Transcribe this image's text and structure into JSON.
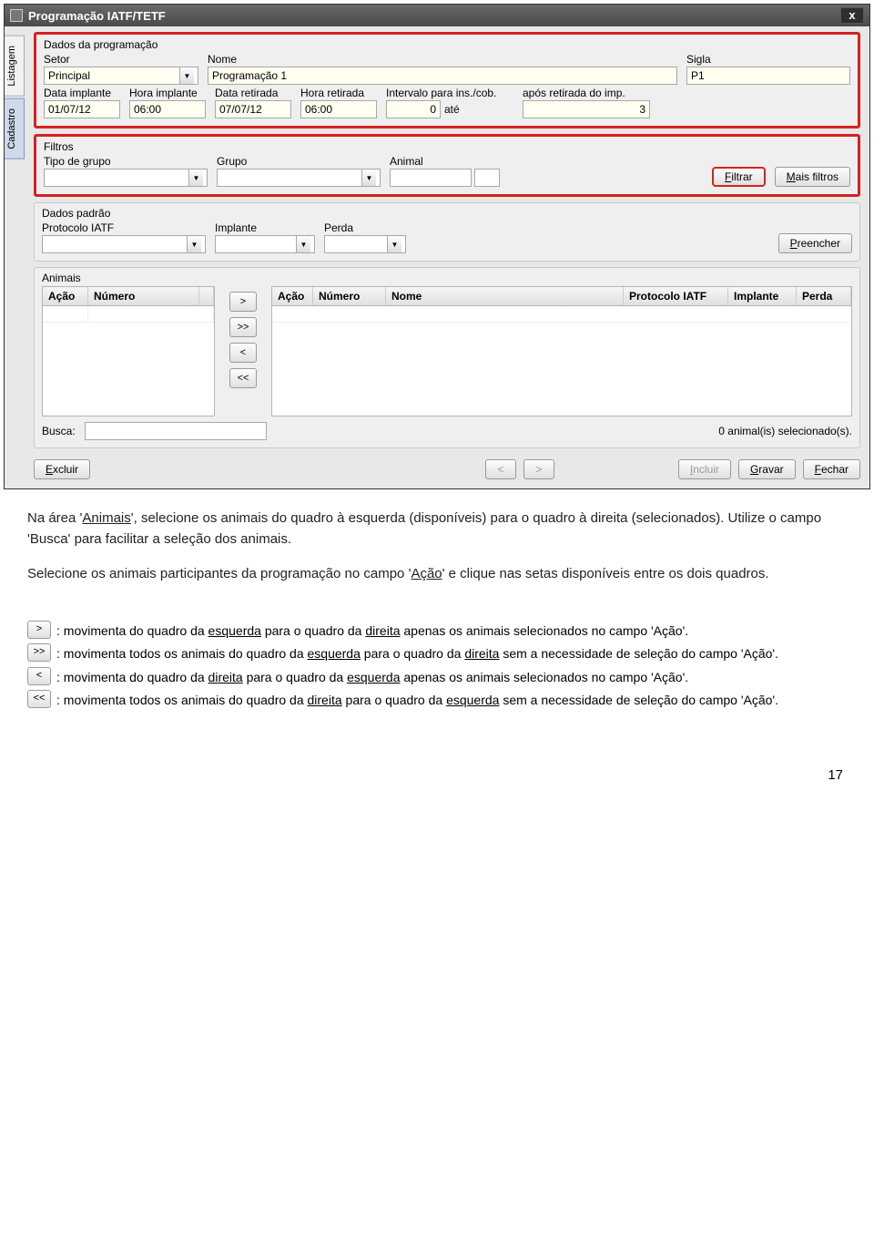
{
  "window": {
    "title": "Programação IATF/TETF",
    "close": "x",
    "tabs": {
      "listagem": "Listagem",
      "cadastro": "Cadastro"
    }
  },
  "dados_prog": {
    "title": "Dados da programação",
    "setor_label": "Setor",
    "setor_value": "Principal",
    "nome_label": "Nome",
    "nome_value": "Programação 1",
    "sigla_label": "Sigla",
    "sigla_value": "P1",
    "data_imp_label": "Data implante",
    "data_imp_value": "01/07/12",
    "hora_imp_label": "Hora implante",
    "hora_imp_value": "06:00",
    "data_ret_label": "Data retirada",
    "data_ret_value": "07/07/12",
    "hora_ret_label": "Hora retirada",
    "hora_ret_value": "06:00",
    "intervalo_label": "Intervalo para ins./cob.",
    "intervalo_value": "0",
    "ate_label": "até",
    "apos_label": "após retirada do imp.",
    "apos_value": "3"
  },
  "filtros": {
    "title": "Filtros",
    "tipo_label": "Tipo de grupo",
    "grupo_label": "Grupo",
    "animal_label": "Animal",
    "filtrar": "Filtrar",
    "mais": "Mais filtros"
  },
  "padrao": {
    "title": "Dados padrão",
    "protocolo_label": "Protocolo IATF",
    "implante_label": "Implante",
    "perda_label": "Perda",
    "preencher": "Preencher"
  },
  "animais": {
    "title": "Animais",
    "left_cols": {
      "acao": "Ação",
      "numero": "Número"
    },
    "right_cols": {
      "acao": "Ação",
      "numero": "Número",
      "nome": "Nome",
      "protocolo": "Protocolo IATF",
      "implante": "Implante",
      "perda": "Perda"
    },
    "xfer": {
      "r": ">",
      "rr": ">>",
      "l": "<",
      "ll": "<<"
    },
    "busca_label": "Busca:",
    "status": "0 animal(is) selecionado(s)."
  },
  "buttons": {
    "excluir": "Excluir",
    "prev": "<",
    "next": ">",
    "incluir": "Incluir",
    "gravar": "Gravar",
    "fechar": "Fechar"
  },
  "explain": {
    "p1a": "Na área '",
    "p1u1": "Animais",
    "p1b": "', selecione os animais do quadro à esquerda (disponíveis) para o quadro à direita (selecionados). Utilize o campo 'Busca' para facilitar a seleção dos animais.",
    "p2a": "Selecione os animais participantes da programação no campo '",
    "p2u1": "Ação",
    "p2b": "' e clique nas setas disponíveis entre os dois quadros."
  },
  "legend": {
    "l1a": " : movimenta do quadro da ",
    "l1u1": "esquerda",
    "l1b": " para o quadro da ",
    "l1u2": "direita",
    "l1c": " apenas os animais selecionados no campo 'Ação'.",
    "l2a": " : movimenta todos os animais do quadro da ",
    "l2u1": "esquerda",
    "l2b": " para o quadro da ",
    "l2u2": "direita",
    "l2c": " sem a necessidade de seleção do campo 'Ação'.",
    "l3a": " : movimenta do quadro da ",
    "l3u1": "direita",
    "l3b": " para o quadro da ",
    "l3u2": "esquerda",
    "l3c": " apenas os animais selecionados no campo 'Ação'.",
    "l4a": " : movimenta todos os animais do quadro da ",
    "l4u1": "direita",
    "l4b": " para o quadro da ",
    "l4u2": "esquerda",
    "l4c": " sem a necessidade de seleção do campo 'Ação'."
  },
  "pagenum": "17"
}
